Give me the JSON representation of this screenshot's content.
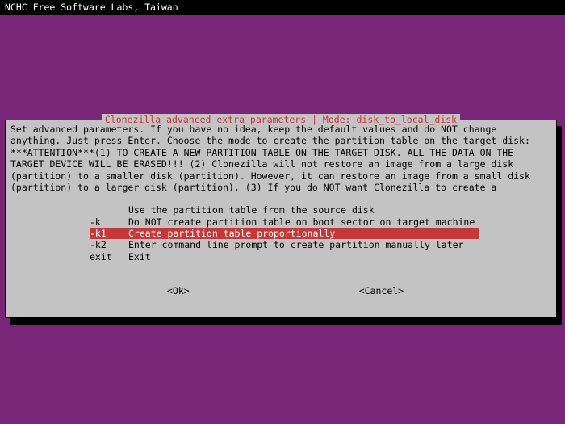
{
  "topbar": {
    "title": "NCHC Free Software Labs, Taiwan"
  },
  "dialog": {
    "title": "Clonezilla advanced extra parameters | Mode: disk_to_local_disk",
    "body": "Set advanced parameters. If you have no idea, keep the default values and do NOT change anything. Just press Enter. Choose the mode to create the partition table on the target disk: ***ATTENTION***(1) TO CREATE A NEW PARTITION TABLE ON THE TARGET DISK. ALL THE DATA ON THE TARGET DEVICE WILL BE ERASED!!! (2) Clonezilla will not restore an image from a large disk (partition) to a smaller disk (partition). However, it can restore an image from a small disk (partition) to a larger disk (partition). (3) If you do NOT want Clonezilla to create a",
    "options": [
      {
        "flag": "",
        "desc": "Use the partition table from the source disk",
        "selected": false
      },
      {
        "flag": "-k",
        "desc": "Do NOT create partition table on boot sector on target machine",
        "selected": false
      },
      {
        "flag": "-k1",
        "desc": "Create partition table proportionally",
        "selected": true
      },
      {
        "flag": "-k2",
        "desc": "Enter command line prompt to create partition manually later",
        "selected": false
      },
      {
        "flag": "exit",
        "desc": "Exit",
        "selected": false
      }
    ],
    "buttons": {
      "ok": "<Ok>",
      "cancel": "<Cancel>"
    }
  }
}
